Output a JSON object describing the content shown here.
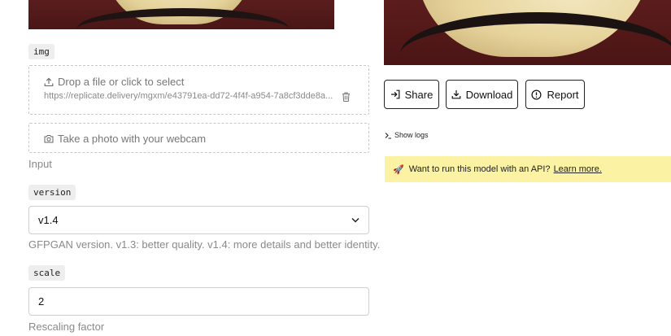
{
  "inputs": {
    "img": {
      "tag": "img",
      "drop_text": "Drop a file or click to select",
      "file_url": "https://replicate.delivery/mgxm/e43791ea-dd72-4f4f-a954-7a8cf3dde8a...",
      "webcam_text": "Take a photo with your webcam",
      "helper": "Input"
    },
    "version": {
      "tag": "version",
      "value": "v1.4",
      "helper": "GFPGAN version. v1.3: better quality. v1.4: more details and better identity."
    },
    "scale": {
      "tag": "scale",
      "value": "2",
      "helper": "Rescaling factor"
    }
  },
  "output": {
    "actions": {
      "share": "Share",
      "download": "Download",
      "report": "Report"
    },
    "show_logs": "Show logs",
    "api_banner": {
      "emoji": "🚀",
      "text": "Want to run this model with an API?",
      "link": "Learn more."
    }
  },
  "icons": [
    "upload-icon",
    "trash-icon",
    "camera-icon",
    "chevron-down-icon",
    "share-icon",
    "download-icon",
    "report-icon",
    "terminal-icon",
    "rocket-icon"
  ],
  "colors": {
    "banner_bg": "#fbf3a3",
    "border": "#cfcfcf"
  }
}
